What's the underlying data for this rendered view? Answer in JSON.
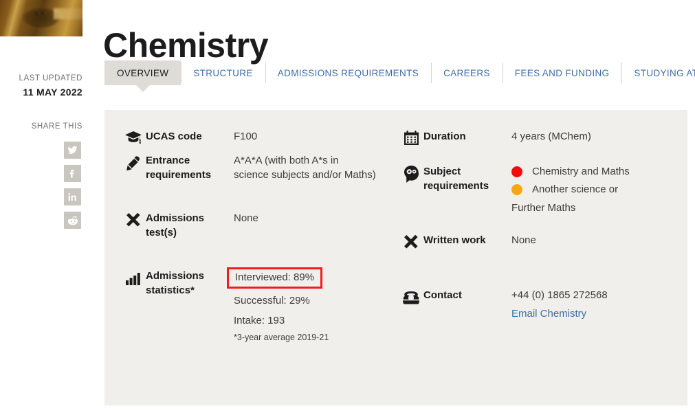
{
  "page": {
    "title": "Chemistry"
  },
  "meta": {
    "last_updated_label": "LAST UPDATED",
    "last_updated_value": "11 MAY 2022",
    "share_label": "SHARE THIS",
    "share_buttons": [
      {
        "name": "twitter-icon",
        "label": "Twitter"
      },
      {
        "name": "facebook-icon",
        "label": "Facebook"
      },
      {
        "name": "linkedin-icon",
        "label": "LinkedIn"
      },
      {
        "name": "reddit-icon",
        "label": "Reddit"
      }
    ]
  },
  "tabs": [
    {
      "label": "OVERVIEW",
      "active": true
    },
    {
      "label": "STRUCTURE",
      "active": false
    },
    {
      "label": "ADMISSIONS REQUIREMENTS",
      "active": false
    },
    {
      "label": "CAREERS",
      "active": false
    },
    {
      "label": "FEES AND FUNDING",
      "active": false
    },
    {
      "label": "STUDYING AT OXFORD",
      "active": false
    }
  ],
  "panel": {
    "left": {
      "ucas": {
        "icon": "graduation-cap-icon",
        "label": "UCAS code",
        "value": "F100"
      },
      "entrance": {
        "icon": "pencil-icon",
        "label": "Entrance requirements",
        "value_line1": "A*A*A (with both A*s in",
        "value_line2": "science subjects and/or Maths)"
      },
      "admissions_test": {
        "icon": "x-mark-icon",
        "label": "Admissions test(s)",
        "value": "None"
      },
      "admissions_stats": {
        "icon": "bar-chart-icon",
        "label": "Admissions statistics*",
        "interviewed": "Interviewed: 89%",
        "successful": "Successful: 29%",
        "intake": "Intake: 193",
        "footnote": "*3-year average 2019-21",
        "highlight_color": "#f01b1b"
      }
    },
    "right": {
      "duration": {
        "icon": "calendar-icon",
        "label": "Duration",
        "value": "4 years (MChem)"
      },
      "subject_requirements": {
        "icon": "head-gears-icon",
        "label": "Subject requirements",
        "items": [
          {
            "color": "#f40c0c",
            "text": "Chemistry and Maths"
          },
          {
            "color": "#f7a811",
            "text": "Another science or"
          }
        ],
        "continuation": "Further Maths"
      },
      "written_work": {
        "icon": "x-mark-icon",
        "label": "Written work",
        "value": "None"
      },
      "contact": {
        "icon": "telephone-icon",
        "label": "Contact",
        "phone": "+44 (0) 1865 272568",
        "email_link": "Email Chemistry"
      }
    }
  },
  "colors": {
    "link": "#3d6da5",
    "panel_bg": "#f1efeb",
    "active_tab_bg": "#dedcd6"
  }
}
